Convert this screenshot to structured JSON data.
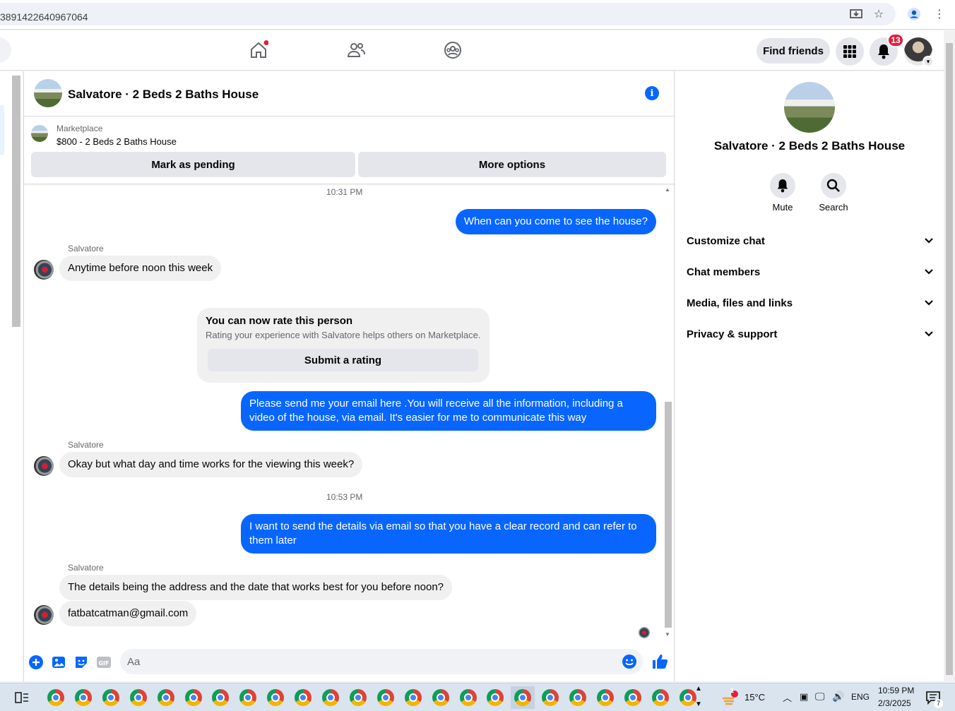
{
  "browser": {
    "url": "3891422640967064"
  },
  "nav": {
    "find_friends": "Find friends",
    "notification_count": "13"
  },
  "chat": {
    "title": "Salvatore · 2 Beds 2 Baths House",
    "marketplace_label": "Marketplace",
    "listing": "$800 - 2 Beds 2 Baths House",
    "mark_pending": "Mark as pending",
    "more_options": "More options",
    "messages": {
      "ts1": "10:31 PM",
      "m1": "When can you come to see the house?",
      "sender": "Salvatore",
      "m2": "Anytime before noon this week",
      "rate_title": "You can now rate this person",
      "rate_desc": "Rating your experience with Salvatore helps others on Marketplace.",
      "rate_button": "Submit a rating",
      "m3": "Please send me your email here .You will receive all the information, including a video of the house, via email. It's easier for me to communicate this way",
      "m4": "Okay but what day and time works for the viewing this week?",
      "ts2": "10:53 PM",
      "m5": "I want to send the details via email so that you have a clear record and can refer to them later",
      "m6": "The details being the address and the date that works best for you before noon?",
      "m7": "fatbatcatman@gmail.com"
    },
    "composer_placeholder": "Aa"
  },
  "panel": {
    "title": "Salvatore · 2 Beds 2 Baths House",
    "mute": "Mute",
    "search": "Search",
    "sections": [
      "Customize chat",
      "Chat members",
      "Media, files and links",
      "Privacy & support"
    ]
  },
  "taskbar": {
    "temperature": "15°C",
    "language": "ENG",
    "time": "10:59 PM",
    "date": "2/3/2025",
    "weather_badge": "1",
    "notif_count": "7"
  },
  "colors": {
    "accent": "#0866ff",
    "badge": "#e41e3f"
  }
}
